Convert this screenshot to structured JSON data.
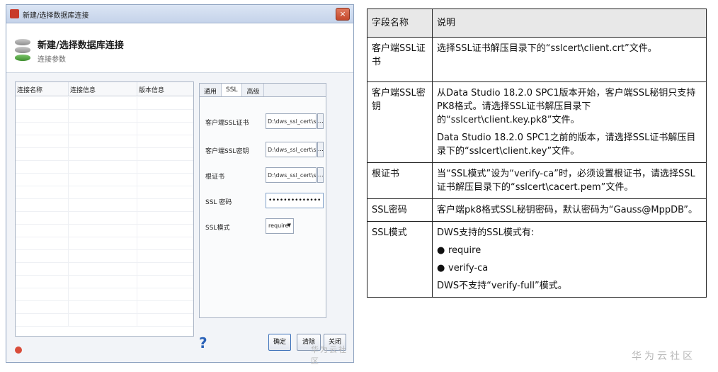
{
  "dialog": {
    "title": "新建/选择数据库连接",
    "close_label": "×",
    "header_title": "新建/选择数据库连接",
    "header_sub": "连接参数",
    "list_columns": [
      "连接名称",
      "连接信息",
      "版本信息"
    ],
    "tabs": [
      "通用",
      "SSL",
      "高级"
    ],
    "fields": {
      "client_cert_label": "客户端SSL证书",
      "client_cert_value": "D:\\dws_ssl_cert\\sslcert\\cl",
      "client_key_label": "客户端SSL密钥",
      "client_key_value": "D:\\dws_ssl_cert\\sslcert\\cl",
      "root_cert_label": "根证书",
      "root_cert_value": "D:\\dws_ssl_cert\\sslcert\\ca",
      "browse_label": "...",
      "ssl_password_label": "SSL 密码",
      "ssl_password_value": "••••••••••••••",
      "ssl_mode_label": "SSL模式",
      "ssl_mode_value": "require",
      "ssl_mode_arrow": "▼"
    },
    "help_label": "?",
    "buttons": {
      "ok": "确定",
      "clear": "清除",
      "close": "关闭"
    },
    "watermark": "华为云社区"
  },
  "table": {
    "headers": [
      "字段名称",
      "说明"
    ],
    "rows": [
      {
        "name": "客户端SSL证书",
        "desc": [
          "选择SSL证书解压目录下的“sslcert\\client.crt”文件。"
        ]
      },
      {
        "name": "客户端SSL密钥",
        "desc": [
          "从Data Studio 18.2.0 SPC1版本开始，客户端SSL秘钥只支持PK8格式。请选择SSL证书解压目录下的“sslcert\\client.key.pk8”文件。",
          "Data Studio 18.2.0 SPC1之前的版本，请选择SSL证书解压目录下的“sslcert\\client.key”文件。"
        ]
      },
      {
        "name": "根证书",
        "desc": [
          "当“SSL模式”设为“verify-ca”时，必须设置根证书，请选择SSL证书解压目录下的“sslcert\\cacert.pem”文件。"
        ]
      },
      {
        "name": "SSL密码",
        "desc": [
          "客户端pk8格式SSL秘钥密码，默认密码为“Gauss@MppDB”。"
        ]
      },
      {
        "name": "SSL模式",
        "desc": [
          "DWS支持的SSL模式有:"
        ],
        "bullets": [
          "require",
          "verify-ca"
        ],
        "note": "DWS不支持“verify-full”模式。"
      }
    ],
    "bullet_glyph": "●",
    "watermark": "华为云社区"
  }
}
